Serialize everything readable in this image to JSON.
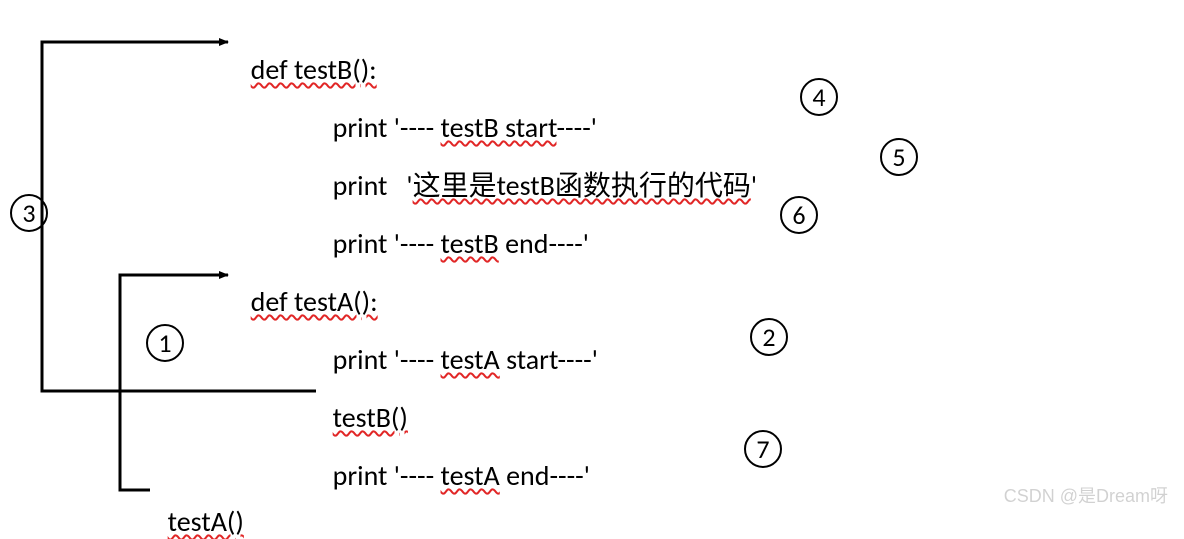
{
  "code": {
    "testB_def": "def testB():",
    "testB_body1_a": "print '---- ",
    "testB_body1_b": "testB start",
    "testB_body1_c": "----'",
    "testB_body2_a": "print   '",
    "testB_body2_b": "这里是testB函数执行的代码",
    "testB_body2_c": "'",
    "testB_body3_a": "print '---- ",
    "testB_body3_b": "testB",
    "testB_body3_c": " end----'",
    "testA_def": "def testA():",
    "testA_body1_a": "print '---- ",
    "testA_body1_b": "testA",
    "testA_body1_c": " start----'",
    "testA_body2": "testB()",
    "testA_body3_a": "print '---- ",
    "testA_body3_b": "testA",
    "testA_body3_c": " end----'",
    "call_testA": "testA()"
  },
  "markers": {
    "m1": "1",
    "m2": "2",
    "m3": "3",
    "m4": "4",
    "m5": "5",
    "m6": "6",
    "m7": "7"
  },
  "watermark": "CSDN @是Dream呀"
}
